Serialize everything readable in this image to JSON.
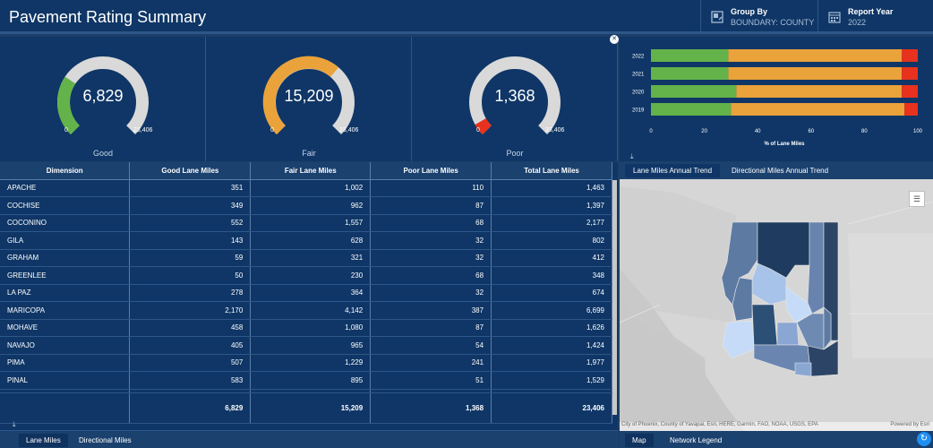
{
  "header": {
    "title": "Pavement Rating Summary",
    "group_by_label": "Group By",
    "group_by_value": "BOUNDARY: COUNTY",
    "report_year_label": "Report Year",
    "report_year_value": "2022"
  },
  "gauges": [
    {
      "value": "6,829",
      "min": "0",
      "max": "23,406",
      "caption": "Good",
      "color": "#64b34a",
      "fraction": 0.292
    },
    {
      "value": "15,209",
      "min": "0",
      "max": "23,406",
      "caption": "Fair",
      "color": "#eaa23a",
      "fraction": 0.65
    },
    {
      "value": "1,368",
      "min": "0",
      "max": "23,406",
      "caption": "Poor",
      "color": "#e8321e",
      "fraction": 0.058
    }
  ],
  "table": {
    "headers": [
      "Dimension",
      "Good Lane Miles",
      "Fair Lane Miles",
      "Poor Lane Miles",
      "Total Lane Miles"
    ],
    "rows": [
      [
        "APACHE",
        "351",
        "1,002",
        "110",
        "1,463"
      ],
      [
        "COCHISE",
        "349",
        "962",
        "87",
        "1,397"
      ],
      [
        "COCONINO",
        "552",
        "1,557",
        "68",
        "2,177"
      ],
      [
        "GILA",
        "143",
        "628",
        "32",
        "802"
      ],
      [
        "GRAHAM",
        "59",
        "321",
        "32",
        "412"
      ],
      [
        "GREENLEE",
        "50",
        "230",
        "68",
        "348"
      ],
      [
        "LA PAZ",
        "278",
        "364",
        "32",
        "674"
      ],
      [
        "MARICOPA",
        "2,170",
        "4,142",
        "387",
        "6,699"
      ],
      [
        "MOHAVE",
        "458",
        "1,080",
        "87",
        "1,626"
      ],
      [
        "NAVAJO",
        "405",
        "965",
        "54",
        "1,424"
      ],
      [
        "PIMA",
        "507",
        "1,229",
        "241",
        "1,977"
      ],
      [
        "PINAL",
        "583",
        "895",
        "51",
        "1,529"
      ]
    ],
    "totals": [
      "",
      "6,829",
      "15,209",
      "1,368",
      "23,406"
    ]
  },
  "bottom_tabs": [
    "Lane Miles",
    "Directional Miles"
  ],
  "chart_data": {
    "type": "bar",
    "orientation": "horizontal",
    "stacked": true,
    "categories": [
      "2022",
      "2021",
      "2020",
      "2019"
    ],
    "series": [
      {
        "values": [
          29,
          29,
          32,
          30
        ],
        "color": "#64b34a"
      },
      {
        "values": [
          65,
          65,
          62,
          65
        ],
        "color": "#eaa23a"
      },
      {
        "values": [
          6,
          6,
          6,
          5
        ],
        "color": "#e8321e"
      }
    ],
    "xticks": [
      "0",
      "20",
      "40",
      "60",
      "80",
      "100"
    ],
    "xlabel": "% of Lane Miles",
    "xlim": [
      0,
      100
    ]
  },
  "map_tabs": [
    "Lane Miles Annual Trend",
    "Directional Miles Annual Trend"
  ],
  "map": {
    "attribution": "City of Phoenix, County of Yavapai, Esri, HERE, Garmin, FAO, NOAA, USGS, EPA",
    "powered_by": "Powered by Esri"
  },
  "map_bottom_tabs": [
    "Map",
    "Network Legend"
  ],
  "icons": {
    "group_by": "group-by-icon",
    "report_year": "calendar-icon",
    "legend": "legend-icon",
    "refresh": "refresh-icon",
    "download": "download-icon"
  }
}
